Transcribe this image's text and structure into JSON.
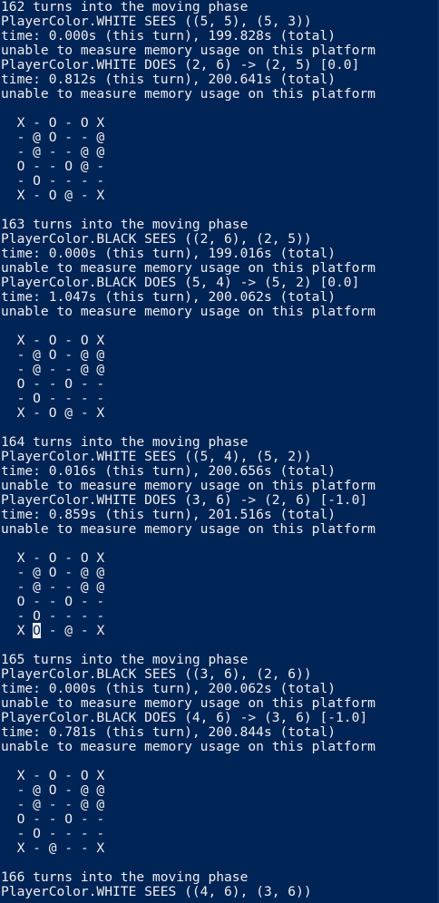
{
  "terminal": {
    "background": "#012456",
    "foreground": "#eeedf0",
    "lines": [
      "162 turns into the moving phase",
      "PlayerColor.WHITE SEES ((5, 5), (5, 3))",
      "time: 0.000s (this turn), 199.828s (total)",
      "unable to measure memory usage on this platform",
      "PlayerColor.WHITE DOES (2, 6) -> (2, 5) [0.0]",
      "time: 0.812s (this turn), 200.641s (total)",
      "unable to measure memory usage on this platform",
      "",
      "  X - O - O X",
      "  - @ O - - @",
      "  - @ - - @ @",
      "  O - - O @ -",
      "  - O - - - -",
      "  X - O @ - X",
      "",
      "163 turns into the moving phase",
      "PlayerColor.BLACK SEES ((2, 6), (2, 5))",
      "time: 0.000s (this turn), 199.016s (total)",
      "unable to measure memory usage on this platform",
      "PlayerColor.BLACK DOES (5, 4) -> (5, 2) [0.0]",
      "time: 1.047s (this turn), 200.062s (total)",
      "unable to measure memory usage on this platform",
      "",
      "  X - O - O X",
      "  - @ O - @ @",
      "  - @ - - @ @",
      "  O - - O - -",
      "  - O - - - -",
      "  X - O @ - X",
      "",
      "164 turns into the moving phase",
      "PlayerColor.WHITE SEES ((5, 4), (5, 2))",
      "time: 0.016s (this turn), 200.656s (total)",
      "unable to measure memory usage on this platform",
      "PlayerColor.WHITE DOES (3, 6) -> (2, 6) [-1.0]",
      "time: 0.859s (this turn), 201.516s (total)",
      "unable to measure memory usage on this platform",
      "",
      "  X - O - O X",
      "  - @ O - @ @",
      "  - @ - - @ @",
      "  O - - O - -",
      "  - O - - - -",
      "  X O - @ - X",
      "",
      "165 turns into the moving phase",
      "PlayerColor.BLACK SEES ((3, 6), (2, 6))",
      "time: 0.000s (this turn), 200.062s (total)",
      "unable to measure memory usage on this platform",
      "PlayerColor.BLACK DOES (4, 6) -> (3, 6) [-1.0]",
      "time: 0.781s (this turn), 200.844s (total)",
      "unable to measure memory usage on this platform",
      "",
      "  X - O - O X",
      "  - @ O - @ @",
      "  - @ - - @ @",
      "  O - - O - -",
      "  - O - - - -",
      "  X - @ - - X",
      "",
      "166 turns into the moving phase",
      "PlayerColor.WHITE SEES ((4, 6), (3, 6))"
    ],
    "cursor": {
      "line": 43,
      "column": 4
    }
  }
}
